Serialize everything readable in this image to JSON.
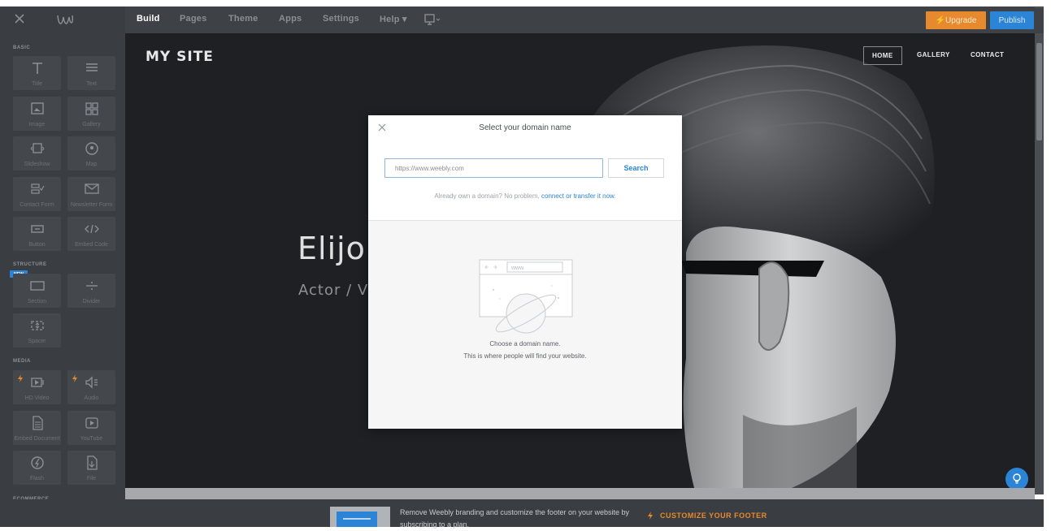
{
  "toolbar": {
    "tabs": [
      {
        "label": "Build",
        "active": true
      },
      {
        "label": "Pages"
      },
      {
        "label": "Theme"
      },
      {
        "label": "Apps"
      },
      {
        "label": "Settings"
      },
      {
        "label": "Help ▾"
      },
      {
        "label": "▾"
      }
    ],
    "upgrade_label": "⚡Upgrade",
    "publish_label": "Publish"
  },
  "sidebar": {
    "sections": [
      "BASIC",
      "STRUCTURE",
      "MEDIA",
      "ECOMMERCE"
    ],
    "new_badge": "NEW",
    "tiles": [
      {
        "label": "Title",
        "icon": "title-icon"
      },
      {
        "label": "Text",
        "icon": "text-icon"
      },
      {
        "label": "Image",
        "icon": "image-icon"
      },
      {
        "label": "Gallery",
        "icon": "gallery-icon"
      },
      {
        "label": "Slideshow",
        "icon": "slideshow-icon"
      },
      {
        "label": "Map",
        "icon": "map-icon"
      },
      {
        "label": "Contact Form",
        "icon": "contact-form-icon"
      },
      {
        "label": "Newsletter Form",
        "icon": "newsletter-icon"
      },
      {
        "label": "Button",
        "icon": "button-icon"
      },
      {
        "label": "Embed Code",
        "icon": "embed-code-icon"
      },
      {
        "label": "Section",
        "icon": "section-icon"
      },
      {
        "label": "Divider",
        "icon": "divider-icon"
      },
      {
        "label": "Spacer",
        "icon": "spacer-icon"
      },
      {
        "label": "HD Video",
        "icon": "hd-video-icon",
        "premium": true
      },
      {
        "label": "Audio",
        "icon": "audio-icon",
        "premium": true
      },
      {
        "label": "Embed Document",
        "icon": "document-icon"
      },
      {
        "label": "YouTube",
        "icon": "youtube-icon"
      },
      {
        "label": "Flash",
        "icon": "flash-icon"
      },
      {
        "label": "File",
        "icon": "file-icon"
      },
      {
        "label": "",
        "icon": "product-grid-icon"
      },
      {
        "label": "",
        "icon": "product-list-icon"
      }
    ]
  },
  "site": {
    "title": "MY SITE",
    "nav": [
      "HOME",
      "GALLERY",
      "CONTACT"
    ],
    "hero_name": "Elijo",
    "hero_sub": "Actor / V"
  },
  "modal": {
    "title": "Select your domain name",
    "input_value": "https://www.weebly.com",
    "search_label": "Search",
    "already_text": "Already own a domain? No problem,",
    "already_link": "connect or transfer it now",
    "illustration_url_text": "www.",
    "empty_line1": "Choose a domain name.",
    "empty_line2": "This is where people will find your website."
  },
  "footer": {
    "promo_text": "Remove Weebly branding and customize the footer on your website by subscribing to a plan.",
    "cta_label": "CUSTOMIZE YOUR FOOTER"
  },
  "colors": {
    "accent_blue": "#2b84d6",
    "upgrade_orange": "#e78a2d",
    "toolbar_bg": "#3e4146",
    "sidebar_bg": "#3a3d42"
  }
}
